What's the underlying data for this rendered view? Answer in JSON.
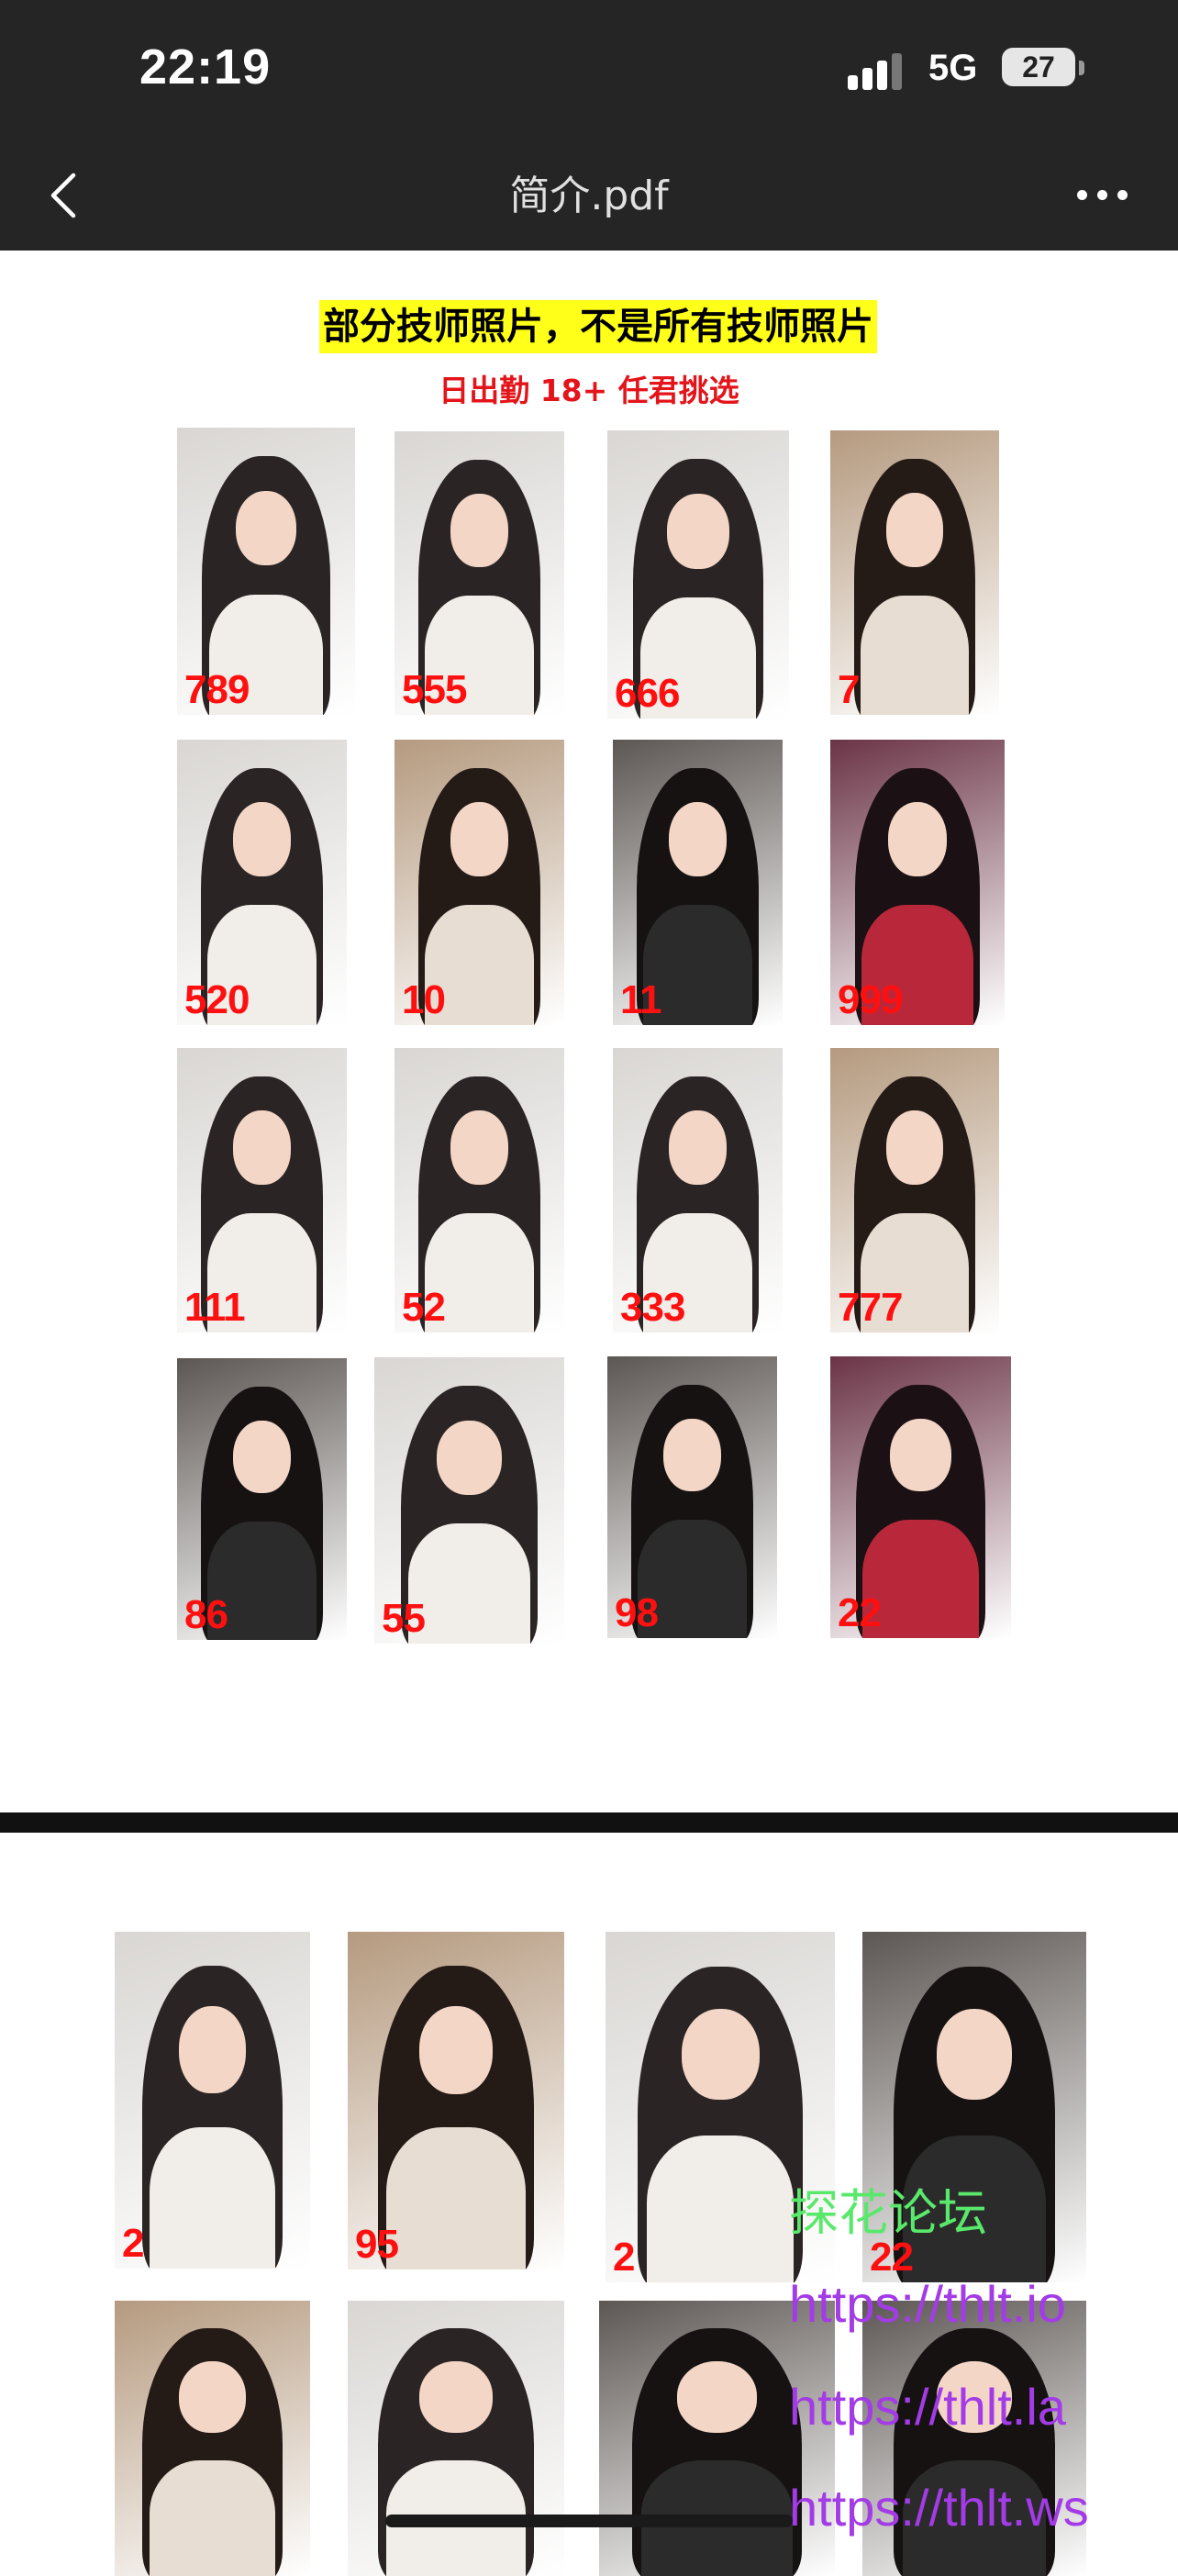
{
  "status_bar": {
    "time": "22:19",
    "network": "5G",
    "battery": "27"
  },
  "nav": {
    "title": "简介.pdf",
    "back_icon": "chevron-left-icon",
    "more_icon": "more-horizontal-icon"
  },
  "page1": {
    "headline": "部分技师照片，不是所有技师照片",
    "subline": "日出勤 18+  任君挑选",
    "photos": [
      {
        "label": "789",
        "palette": "light"
      },
      {
        "label": "555",
        "palette": "light"
      },
      {
        "label": "666",
        "palette": "light"
      },
      {
        "label": "7",
        "palette": "warm"
      },
      {
        "label": "520",
        "palette": "light"
      },
      {
        "label": "10",
        "palette": "warm"
      },
      {
        "label": "11",
        "palette": "dark"
      },
      {
        "label": "999",
        "palette": "red"
      },
      {
        "label": "111",
        "palette": "light"
      },
      {
        "label": "52",
        "palette": "light"
      },
      {
        "label": "333",
        "palette": "light"
      },
      {
        "label": "777",
        "palette": "warm"
      },
      {
        "label": "86",
        "palette": "dark"
      },
      {
        "label": "55",
        "palette": "light"
      },
      {
        "label": "98",
        "palette": "dark"
      },
      {
        "label": "22",
        "palette": "red"
      }
    ]
  },
  "page2": {
    "photos": [
      {
        "label": "2",
        "palette": "light"
      },
      {
        "label": "95",
        "palette": "warm"
      },
      {
        "label": "2",
        "palette": "light"
      },
      {
        "label": "22",
        "palette": "dark"
      },
      {
        "label": "",
        "palette": "warm"
      },
      {
        "label": "",
        "palette": "light"
      },
      {
        "label": "",
        "palette": "dark"
      },
      {
        "label": "",
        "palette": "dark"
      }
    ]
  },
  "watermark": {
    "brand": "探花论坛",
    "links": [
      "https://thlt.io",
      "https://thlt.la",
      "https://thlt.ws"
    ]
  },
  "colors": {
    "chrome": "#252525",
    "headline_bg": "#ffff1a",
    "subline": "#e3141a",
    "photo_number": "#ff1010",
    "watermark_green": "#59e86b",
    "watermark_purple": "#a33be6"
  }
}
